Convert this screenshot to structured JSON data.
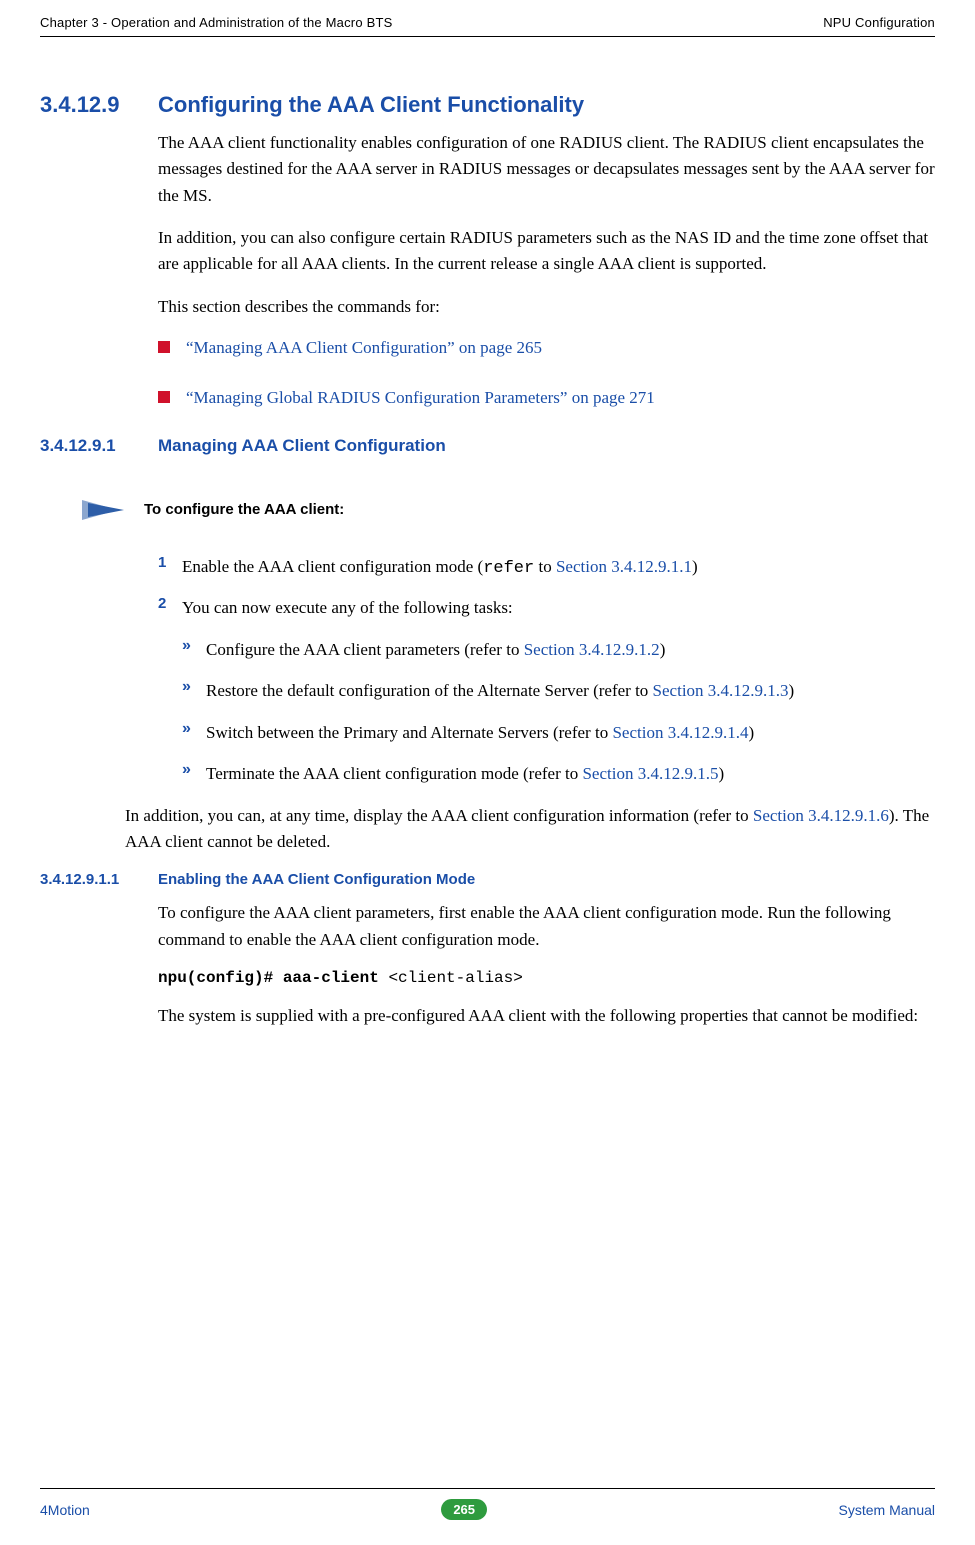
{
  "header": {
    "left": "Chapter 3 - Operation and Administration of the Macro BTS",
    "right": "NPU Configuration"
  },
  "sec1": {
    "num": "3.4.12.9",
    "title": "Configuring the AAA Client Functionality",
    "p1": "The AAA client functionality enables configuration of one RADIUS client. The RADIUS client encapsulates the messages destined for the AAA server in RADIUS messages or decapsulates messages sent by the AAA server for the MS.",
    "p2": "In addition, you can also configure certain RADIUS parameters such as the NAS ID and the time zone offset that are applicable for all AAA clients. In the current release a single AAA client is supported.",
    "p3": "This section describes the commands for:",
    "bul1": "“Managing AAA Client Configuration” on page 265",
    "bul2": "“Managing Global RADIUS Configuration Parameters” on page 271"
  },
  "sec2": {
    "num": "3.4.12.9.1",
    "title": "Managing AAA Client Configuration",
    "proc_title": "To configure the AAA client:",
    "steps": {
      "n1": "1",
      "s1a": "Enable the AAA client configuration mode (",
      "s1_mono": "refer",
      "s1b": " to ",
      "s1_link": "Section 3.4.12.9.1.1",
      "s1c": ")",
      "n2": "2",
      "s2": "You can now execute any of the following tasks:",
      "sub_marker": "»",
      "sub1a": "Configure the AAA client parameters (refer to ",
      "sub1_link": "Section 3.4.12.9.1.2",
      "sub1b": ")",
      "sub2a": "Restore the default configuration of the Alternate Server (refer to ",
      "sub2_link": "Section 3.4.12.9.1.3",
      "sub2b": ")",
      "sub3a": "Switch between the Primary and Alternate Servers (refer to ",
      "sub3_link": "Section 3.4.12.9.1.4",
      "sub3b": ")",
      "sub4a": "Terminate the AAA client configuration mode (refer to ",
      "sub4_link": "Section 3.4.12.9.1.5",
      "sub4b": ")"
    },
    "p_after_a": "In addition, you can, at any time, display the AAA client configuration information (refer to ",
    "p_after_link": "Section 3.4.12.9.1.6",
    "p_after_b": "). The AAA client cannot be deleted."
  },
  "sec3": {
    "num": "3.4.12.9.1.1",
    "title": "Enabling the AAA Client Configuration Mode",
    "p1": "To configure the AAA client parameters, first enable the AAA client configuration mode. Run the following command to enable the AAA client configuration mode.",
    "cmd_bold": "npu(config)# aaa-client ",
    "cmd_arg": "<client-alias>",
    "p2": "The system is supplied with a pre-configured AAA client with the following properties that cannot be modified:"
  },
  "footer": {
    "left": "4Motion",
    "page": "265",
    "right": "System Manual"
  }
}
